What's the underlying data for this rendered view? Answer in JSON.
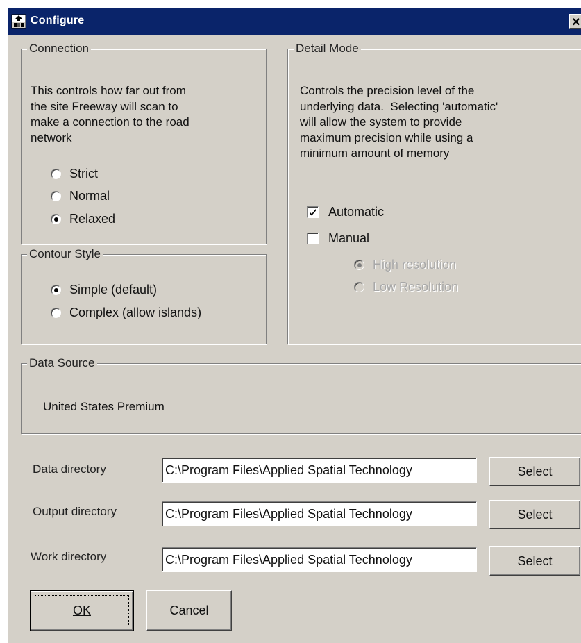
{
  "window": {
    "title": "Configure",
    "close_glyph": "×",
    "icon": "configure-app-icon"
  },
  "connection": {
    "legend": "Connection",
    "description_lines": [
      "This controls how far out from",
      "the site Freeway will scan to",
      "make a connection to the road",
      "network"
    ],
    "options": [
      "Strict",
      "Normal",
      "Relaxed"
    ],
    "selected": "Relaxed"
  },
  "contour": {
    "legend": "Contour Style",
    "options": [
      "Simple (default)",
      "Complex (allow islands)"
    ],
    "selected": "Simple (default)"
  },
  "detail": {
    "legend": "Detail Mode",
    "description_lines": [
      "Controls the precision level of the",
      "underlying data.  Selecting 'automatic'",
      "will allow the system to provide",
      "maximum precision while using a",
      "minimum amount of memory"
    ],
    "automatic_label": "Automatic",
    "automatic_checked": true,
    "manual_label": "Manual",
    "manual_checked": false,
    "resolution_options": [
      "High resolution",
      "Low Resolution"
    ],
    "resolution_selected": "High resolution"
  },
  "data_source": {
    "legend": "Data Source",
    "value": "United States Premium"
  },
  "directories": {
    "data_label": "Data directory",
    "data_value": "C:\\Program Files\\Applied Spatial Technology",
    "output_label": "Output directory",
    "output_value": "C:\\Program Files\\Applied Spatial Technology",
    "work_label": "Work directory",
    "work_value": "C:\\Program Files\\Applied Spatial Technology",
    "select_label": "Select"
  },
  "buttons": {
    "ok_label": "OK",
    "cancel_label": "Cancel"
  }
}
